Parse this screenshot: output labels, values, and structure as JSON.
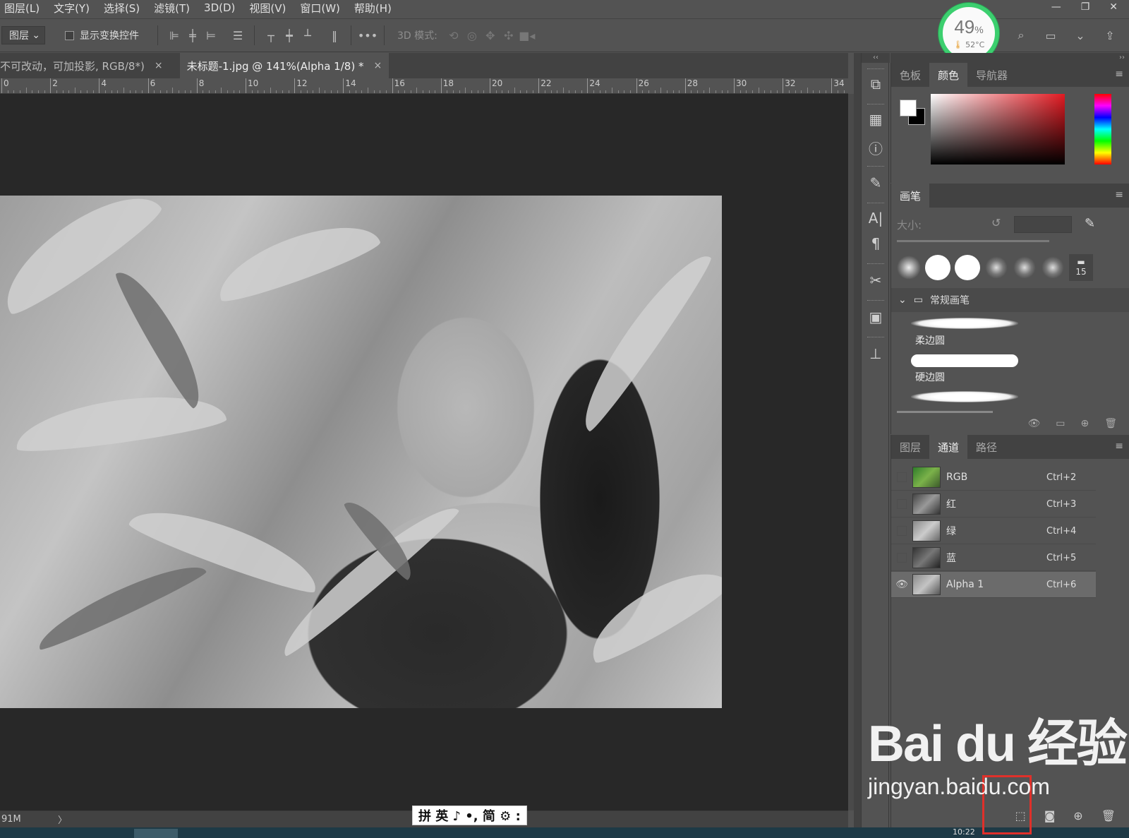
{
  "menu": [
    "图层(L)",
    "文字(Y)",
    "选择(S)",
    "滤镜(T)",
    "3D(D)",
    "视图(V)",
    "窗口(W)",
    "帮助(H)"
  ],
  "window_controls": {
    "minimize": "—",
    "restore": "❐",
    "close": "✕"
  },
  "options_bar": {
    "layer_select": "图层",
    "show_transform_label": "显示变换控件",
    "mode_3d_label": "3D 模式:",
    "more": "•••"
  },
  "gauge": {
    "percent": "49",
    "unit": "%",
    "temp": "52°C"
  },
  "doc_tabs": [
    {
      "title": "不可改动，可加投影, RGB/8*)",
      "close": "×",
      "active": false
    },
    {
      "title": "未标题-1.jpg @ 141%(Alpha 1/8) *",
      "close": "×",
      "active": true
    }
  ],
  "ruler_labels": [
    "0",
    "2",
    "4",
    "6",
    "8",
    "10",
    "12",
    "14",
    "16",
    "18",
    "20",
    "22",
    "24",
    "26",
    "28",
    "30",
    "32",
    "34"
  ],
  "status": {
    "doc_size": "91M",
    "chevron": "〉"
  },
  "ime": {
    "text": "拼 英 ♪ •, 简 ⚙ :"
  },
  "color_panel": {
    "tabs": [
      "色板",
      "颜色",
      "导航器"
    ],
    "active_tab": "颜色",
    "foreground": "#ffffff",
    "background": "#000000",
    "hue_color": "#e21a22"
  },
  "brush_panel": {
    "title": "画笔",
    "size_label": "大小:",
    "tip_size": "15",
    "group_name": "常规画笔",
    "brushes": [
      "柔边圆",
      "硬边圆"
    ]
  },
  "channels_panel": {
    "tabs": [
      "图层",
      "通道",
      "路径"
    ],
    "active_tab": "通道",
    "channels": [
      {
        "name": "RGB",
        "shortcut": "Ctrl+2",
        "visible": false,
        "selected": false
      },
      {
        "name": "红",
        "shortcut": "Ctrl+3",
        "visible": false,
        "selected": false
      },
      {
        "name": "绿",
        "shortcut": "Ctrl+4",
        "visible": false,
        "selected": false
      },
      {
        "name": "蓝",
        "shortcut": "Ctrl+5",
        "visible": false,
        "selected": false
      },
      {
        "name": "Alpha 1",
        "shortcut": "Ctrl+6",
        "visible": true,
        "selected": true
      }
    ]
  },
  "watermark": {
    "logo": "Bai du 经验",
    "site": "jingyan.baidu.com"
  },
  "taskbar": {
    "clock": "10:22"
  }
}
